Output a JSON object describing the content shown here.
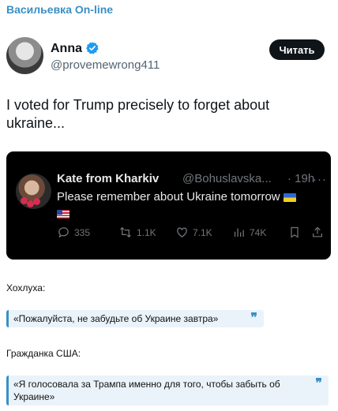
{
  "channel": {
    "name": "Васильевка On-line"
  },
  "tweet": {
    "author_name": "Anna",
    "author_handle": "@provemewrong411",
    "follow_label": "Читать",
    "text": "I voted for Trump precisely to forget about ukraine..."
  },
  "quoted_tweet": {
    "author_name": "Kate from Kharkiv",
    "author_handle": "@Bohuslavska...",
    "time": "· 19h",
    "text": "Please remember about Ukraine tomorrow",
    "stats": {
      "replies": "335",
      "reposts": "1.1K",
      "likes": "7.1K",
      "views": "74K"
    }
  },
  "post": {
    "label_1": "Хохлуха:",
    "quote_1": "«Пожалуйста, не забудьте об Украине завтра»",
    "label_2": "Гражданка США:",
    "quote_2": "«Я голосовала за Трампа именно для того, чтобы забыть об Украине»",
    "quote_mark": "❞"
  },
  "colors": {
    "accent": "#3a8fc4",
    "verified": "#1d9bf0",
    "quote_bg": "#eaf3fa"
  }
}
